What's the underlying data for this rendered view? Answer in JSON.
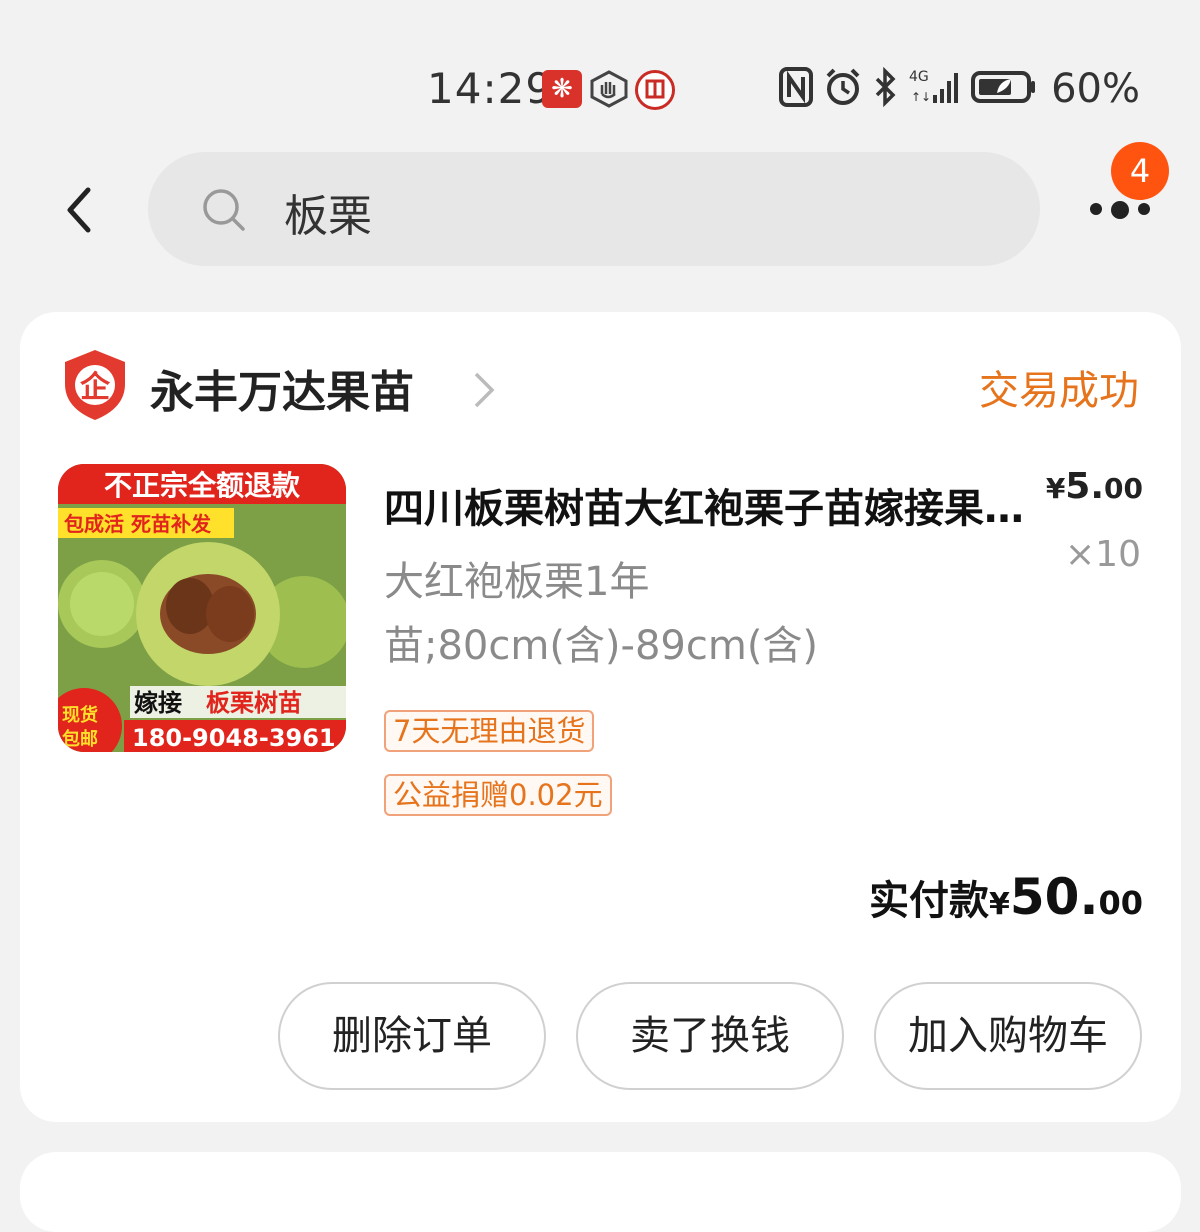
{
  "status_bar": {
    "time": "14:29",
    "battery": "60%",
    "icons": [
      "app-notification-icon",
      "hand-app-icon",
      "bank-app-icon",
      "nfc-icon",
      "alarm-icon",
      "bluetooth-icon",
      "signal-4g-icon",
      "battery-icon"
    ]
  },
  "header": {
    "search_query": "板栗",
    "more_badge": "4"
  },
  "order": {
    "shop_name": "永丰万达果苗",
    "status": "交易成功",
    "product": {
      "title": "四川板栗树苗大红袍栗子苗嫁接果树苗",
      "sku": "大红袍板栗1年苗;80cm(含)-89cm(含)",
      "price_currency": "¥",
      "price_int": "5.",
      "price_dec": "00",
      "quantity": "×10",
      "tags": [
        "7天无理由退货",
        "公益捐赠0.02元"
      ],
      "image_text": {
        "top": "不正宗全额退款",
        "sub": "包成活 死苗补发",
        "graft": "嫁接",
        "name": "板栗树苗",
        "stock": "现货",
        "ship": "包邮",
        "phone": "180-9048-3961"
      }
    },
    "paid": {
      "label": "实付款",
      "currency": "¥",
      "int": "50.",
      "dec": "00"
    },
    "actions": {
      "delete": "删除订单",
      "sell": "卖了换钱",
      "add_cart": "加入购物车"
    }
  },
  "colors": {
    "accent": "#e6741d",
    "badge": "#ff5410",
    "background": "#f2f2f2"
  }
}
